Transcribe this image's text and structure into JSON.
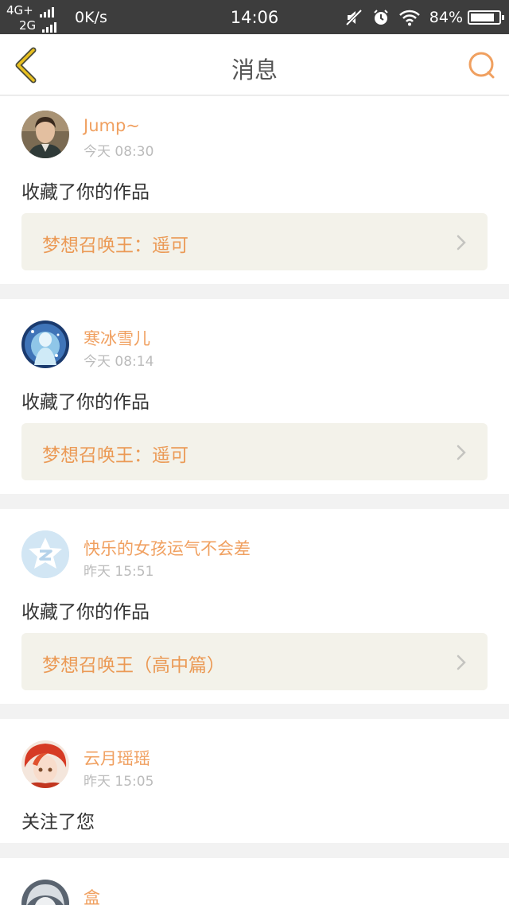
{
  "status_bar": {
    "network1": "4G+",
    "network2": "2G",
    "speed": "0K/s",
    "time": "14:06",
    "battery": "84%",
    "battery_level": 0.84
  },
  "nav": {
    "title": "消息",
    "back_icon": "chevron-left-icon",
    "search_icon": "search-icon"
  },
  "colors": {
    "accent": "#f0a060",
    "back_arrow": "#e8c020",
    "work_title": "#eb9a56"
  },
  "messages": [
    {
      "user": "Jump~",
      "time": "今天 08:30",
      "action": "收藏了你的作品",
      "work": "梦想召唤王：遥可"
    },
    {
      "user": "寒冰雪儿",
      "time": "今天 08:14",
      "action": "收藏了你的作品",
      "work": "梦想召唤王：遥可"
    },
    {
      "user": "快乐的女孩运气不会差",
      "time": "昨天 15:51",
      "action": "收藏了你的作品",
      "work": "梦想召唤王（高中篇）"
    },
    {
      "user": "云月瑶瑶",
      "time": "昨天 15:05",
      "action": "关注了您"
    },
    {
      "user": "盒"
    }
  ]
}
